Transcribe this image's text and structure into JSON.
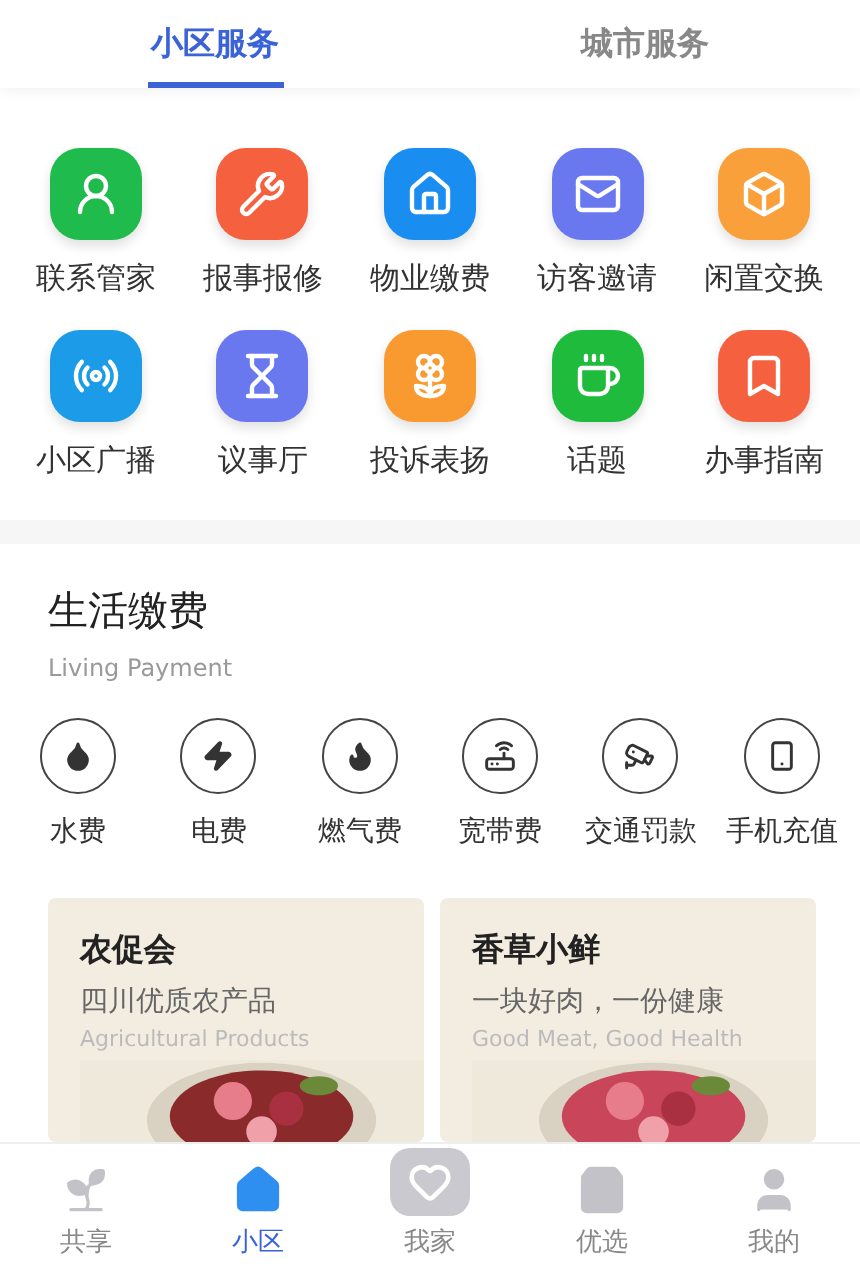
{
  "tabs": [
    {
      "label": "小区服务",
      "selected": true
    },
    {
      "label": "城市服务",
      "selected": false
    }
  ],
  "services": [
    {
      "label": "联系管家",
      "color": "#1fbb4c"
    },
    {
      "label": "报事报修",
      "color": "#f5603f"
    },
    {
      "label": "物业缴费",
      "color": "#1a8ef0"
    },
    {
      "label": "访客邀请",
      "color": "#6a78f0"
    },
    {
      "label": "闲置交换",
      "color": "#f9a03a"
    },
    {
      "label": "小区广播",
      "color": "#1c9be8"
    },
    {
      "label": "议事厅",
      "color": "#6a78f0"
    },
    {
      "label": "投诉表扬",
      "color": "#f99a30"
    },
    {
      "label": "话题",
      "color": "#1fbb3d"
    },
    {
      "label": "办事指南",
      "color": "#f5603f"
    }
  ],
  "living_payment": {
    "title": "生活缴费",
    "subtitle": "Living Payment",
    "items": [
      {
        "label": "水费"
      },
      {
        "label": "电费"
      },
      {
        "label": "燃气费"
      },
      {
        "label": "宽带费"
      },
      {
        "label": "交通罚款"
      },
      {
        "label": "手机充值"
      }
    ]
  },
  "promos": [
    {
      "title": "农促会",
      "subtitle": "四川优质农产品",
      "english": "Agricultural Products",
      "kind": "picture"
    },
    {
      "title": "香草小鲜",
      "subtitle": "一块好肉，一份健康",
      "english": "Good Meat, Good Health",
      "kind": "picture"
    }
  ],
  "bottom_nav": [
    {
      "label": "共享",
      "selected": false
    },
    {
      "label": "小区",
      "selected": true
    },
    {
      "label": "我家",
      "selected": false
    },
    {
      "label": "优选",
      "selected": false
    },
    {
      "label": "我的",
      "selected": false
    }
  ]
}
